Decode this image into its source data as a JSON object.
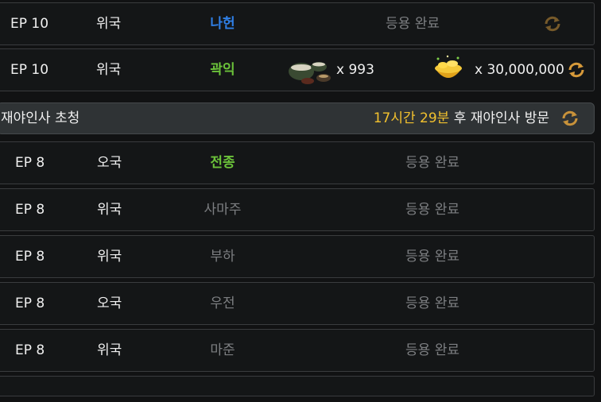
{
  "top_rows": [
    {
      "ep": "EP 10",
      "nation": "위국",
      "name": "나헌",
      "name_color": "blue",
      "status": "등용 완료"
    },
    {
      "ep": "EP 10",
      "nation": "위국",
      "name": "곽익",
      "name_color": "green",
      "reward_item1_qty": "x 993",
      "reward_item2_qty": "x 30,000,000",
      "reward_item1_icon": "wine-jars-icon",
      "reward_item2_icon": "gold-ingot-bowl-icon"
    }
  ],
  "banner": {
    "title": "재야인사 초청",
    "timer_hours": "17시간",
    "timer_minutes": "29분",
    "timer_suffix": "후 재야인사 방문"
  },
  "rows": [
    {
      "ep": "EP 8",
      "nation": "오국",
      "name": "전종",
      "name_color": "green",
      "status": "등용 완료"
    },
    {
      "ep": "EP 8",
      "nation": "위국",
      "name": "사마주",
      "name_color": "gray",
      "status": "등용 완료"
    },
    {
      "ep": "EP 8",
      "nation": "위국",
      "name": "부하",
      "name_color": "gray",
      "status": "등용 완료"
    },
    {
      "ep": "EP 8",
      "nation": "오국",
      "name": "우전",
      "name_color": "gray",
      "status": "등용 완료"
    },
    {
      "ep": "EP 8",
      "nation": "위국",
      "name": "마준",
      "name_color": "gray",
      "status": "등용 완료"
    }
  ],
  "colors": {
    "blue": "#2f7fe6",
    "green": "#6bc23a",
    "gray": "#7d7f82",
    "highlight": "#f2c12e"
  }
}
